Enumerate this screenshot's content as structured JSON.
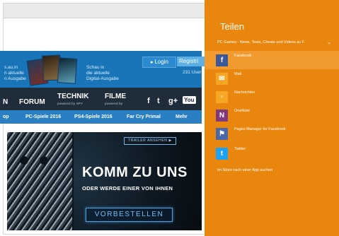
{
  "browser": {
    "login_label": "Login",
    "register_label": "Registri",
    "users_text": "231 User",
    "header_left_text": "s.au.in\nn aktuelle\nn Ausgabe",
    "header_mid_text": "Schau in\ndie aktuelle\nDigital-Ausgabe",
    "nav": {
      "partial": "N",
      "forum": "FORUM",
      "technik": "TECHNIK",
      "technik_sub": "powered by SPY",
      "filme": "FILME",
      "filme_sub": "powered by"
    },
    "social": {
      "facebook": "f",
      "twitter": "t",
      "googleplus": "g+",
      "youtube": "You"
    },
    "sub_nav": [
      "op",
      "PC-Spiele 2016",
      "PS4-Spiele 2016",
      "Far Cry Primal",
      "Mehr"
    ],
    "banner": {
      "trailer_tag": "TRAILER ANSEHEN ▶",
      "headline_main": "KOMM ZU UNS",
      "headline_sub": "ODER WERDE EINER VON IHNEN",
      "order_button": "VORBESTELLEN"
    }
  },
  "share": {
    "title": "Teilen",
    "source": "PC Games - News, Tests, Cheats und Videos zu F",
    "items": [
      {
        "label": "Facebook",
        "icon": "facebook-icon",
        "color": "#3b5998"
      },
      {
        "label": "Mail",
        "icon": "mail-icon",
        "color": "#e8860d"
      },
      {
        "label": "Nachrichten",
        "icon": "messaging-icon",
        "color": "#f19a2e"
      },
      {
        "label": "OneNote",
        "icon": "onenote-icon",
        "color": "#80397b"
      },
      {
        "label": "Pages Manager for Facebook",
        "icon": "pages-manager-icon",
        "color": "#3b5998"
      },
      {
        "label": "Twitter",
        "icon": "twitter-icon",
        "color": "#1da1f2"
      }
    ],
    "store_link": "Im Store nach einer App suchen"
  },
  "colors": {
    "share_bg": "#e8860d",
    "selected_row": "#f19a2e",
    "site_blue": "#1a75b8",
    "nav_dark": "#1f2c3a"
  }
}
